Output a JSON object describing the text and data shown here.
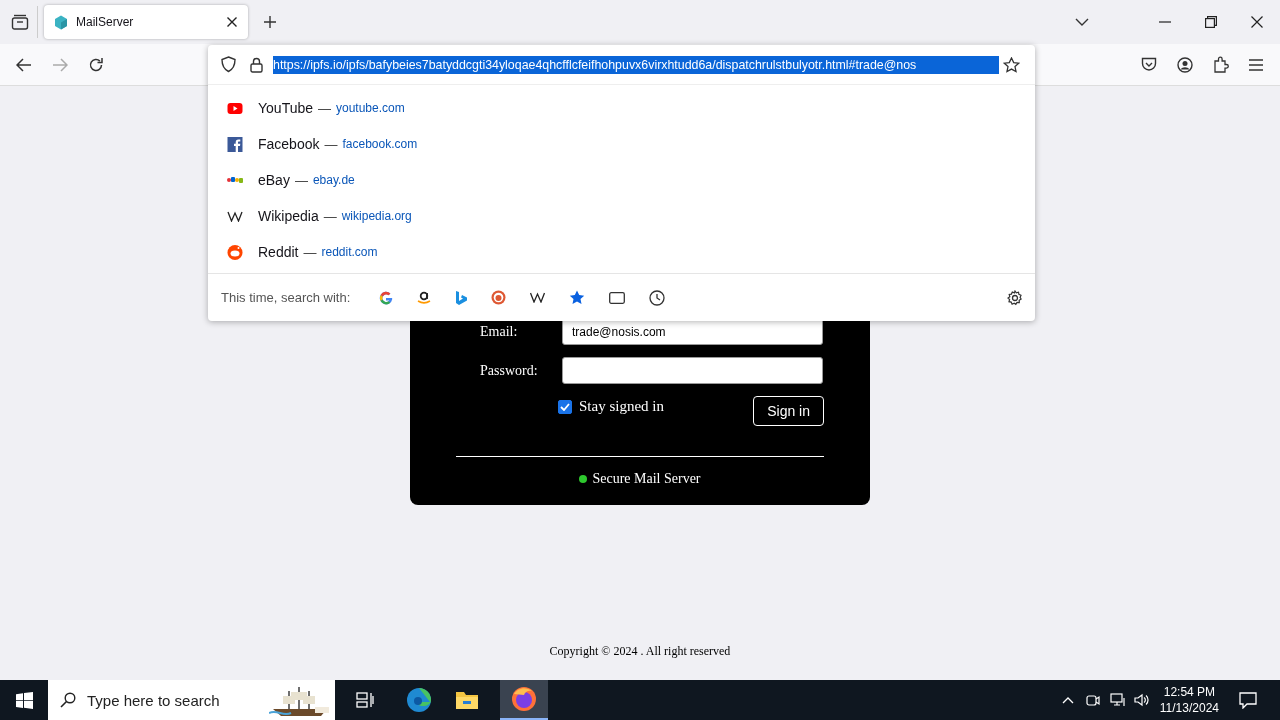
{
  "browser": {
    "tabs": [
      {
        "title": "MailServer",
        "selected": true
      }
    ],
    "url": "https://ipfs.io/ipfs/bafybeies7batyddcgti34yloqae4qhcfflcfeifhohpuvx6virxhtudd6a/dispatchrulstbulyotr.html#trade@nos",
    "suggestions": [
      {
        "title": "YouTube",
        "separator": "—",
        "domain": "youtube.com"
      },
      {
        "title": "Facebook",
        "separator": "—",
        "domain": "facebook.com"
      },
      {
        "title": "eBay",
        "separator": "—",
        "domain": "ebay.de"
      },
      {
        "title": "Wikipedia",
        "separator": "—",
        "domain": "wikipedia.org"
      },
      {
        "title": "Reddit",
        "separator": "—",
        "domain": "reddit.com"
      }
    ],
    "search_with_label": "This time, search with:"
  },
  "login": {
    "email_label": "Email:",
    "email_value": "trade@nosis.com",
    "password_label": "Password:",
    "stay_signed_in": {
      "label": "Stay signed in",
      "checked": true
    },
    "sign_in": "Sign in",
    "status": "Secure Mail Server"
  },
  "copyright": "Copyright © 2024 . All right reserved",
  "taskbar": {
    "search_placeholder": "Type here to search",
    "time": "12:54 PM",
    "date": "11/13/2024"
  }
}
